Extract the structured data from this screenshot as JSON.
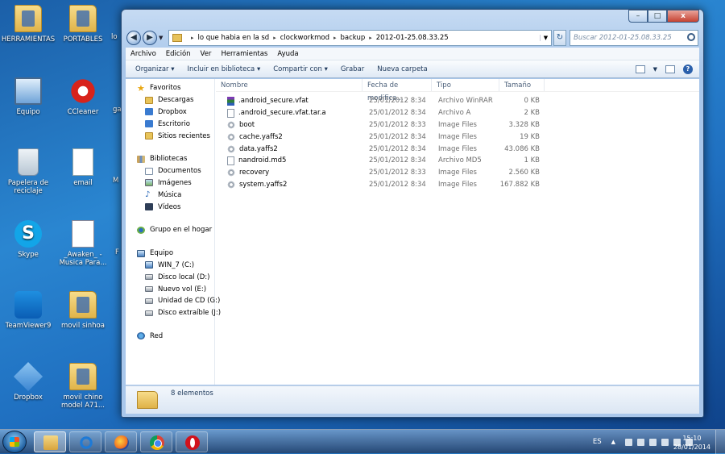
{
  "desktop": {
    "icons": [
      {
        "label": "HERRAMIENTAS",
        "icon": "folder-icon"
      },
      {
        "label": "PORTABLES",
        "icon": "folder-icon"
      },
      {
        "label": "Equipo",
        "icon": "computer-icon"
      },
      {
        "label": "CCleaner",
        "icon": "ccleaner-icon"
      },
      {
        "label": "Papelera de reciclaje",
        "icon": "recycle-bin-icon"
      },
      {
        "label": "email",
        "icon": "document-icon"
      },
      {
        "label": "Skype",
        "icon": "skype-icon"
      },
      {
        "label": "_Awaken_ - Musica Para...",
        "icon": "music-file-icon"
      },
      {
        "label": "TeamViewer9",
        "icon": "teamviewer-icon"
      },
      {
        "label": "movil sinhoa",
        "icon": "folder-icon"
      },
      {
        "label": "Dropbox",
        "icon": "dropbox-icon"
      },
      {
        "label": "movil chino model A71...",
        "icon": "folder-icon"
      }
    ],
    "partial_labels": [
      "lo",
      "ga",
      "M",
      "F"
    ]
  },
  "window": {
    "controls": {
      "minimize": "–",
      "maximize": "□",
      "close": "x"
    },
    "breadcrumb": [
      "lo que habia en la sd",
      "clockworkmod",
      "backup",
      "2012-01-25.08.33.25"
    ],
    "search_placeholder": "Buscar 2012-01-25.08.33.25",
    "menu": [
      "Archivo",
      "Edición",
      "Ver",
      "Herramientas",
      "Ayuda"
    ],
    "toolbar": [
      "Organizar ▾",
      "Incluir en biblioteca ▾",
      "Compartir con ▾",
      "Grabar",
      "Nueva carpeta"
    ],
    "nav_pane": {
      "favorites": {
        "label": "Favoritos",
        "items": [
          "Descargas",
          "Dropbox",
          "Escritorio",
          "Sitios recientes"
        ]
      },
      "libraries": {
        "label": "Bibliotecas",
        "items": [
          "Documentos",
          "Imágenes",
          "Música",
          "Vídeos"
        ]
      },
      "homegroup": {
        "label": "Grupo en el hogar"
      },
      "computer": {
        "label": "Equipo",
        "items": [
          "WIN_7 (C:)",
          "Disco local (D:)",
          "Nuevo vol (E:)",
          "Unidad de CD (G:)",
          "Disco extraíble (J:)"
        ]
      },
      "network": {
        "label": "Red"
      }
    },
    "columns": {
      "name": "Nombre",
      "date": "Fecha de modifica...",
      "type": "Tipo",
      "size": "Tamaño"
    },
    "files": [
      {
        "name": ".android_secure.vfat",
        "date": "25/01/2012 8:34",
        "type": "Archivo WinRAR",
        "size": "0 KB",
        "icon": "rar"
      },
      {
        "name": ".android_secure.vfat.tar.a",
        "date": "25/01/2012 8:34",
        "type": "Archivo A",
        "size": "2 KB",
        "icon": "file"
      },
      {
        "name": "boot",
        "date": "25/01/2012 8:33",
        "type": "Image Files",
        "size": "3.328 KB",
        "icon": "gear"
      },
      {
        "name": "cache.yaffs2",
        "date": "25/01/2012 8:34",
        "type": "Image Files",
        "size": "19 KB",
        "icon": "gear"
      },
      {
        "name": "data.yaffs2",
        "date": "25/01/2012 8:34",
        "type": "Image Files",
        "size": "43.086 KB",
        "icon": "gear"
      },
      {
        "name": "nandroid.md5",
        "date": "25/01/2012 8:34",
        "type": "Archivo MD5",
        "size": "1 KB",
        "icon": "file"
      },
      {
        "name": "recovery",
        "date": "25/01/2012 8:33",
        "type": "Image Files",
        "size": "2.560 KB",
        "icon": "gear"
      },
      {
        "name": "system.yaffs2",
        "date": "25/01/2012 8:34",
        "type": "Image Files",
        "size": "167.882 KB",
        "icon": "gear"
      }
    ],
    "status": "8 elementos"
  },
  "taskbar": {
    "apps": [
      "explorer",
      "internet-explorer",
      "firefox",
      "chrome",
      "opera"
    ],
    "tray_language": "ES",
    "time": "15:10",
    "date": "28/01/2014"
  }
}
